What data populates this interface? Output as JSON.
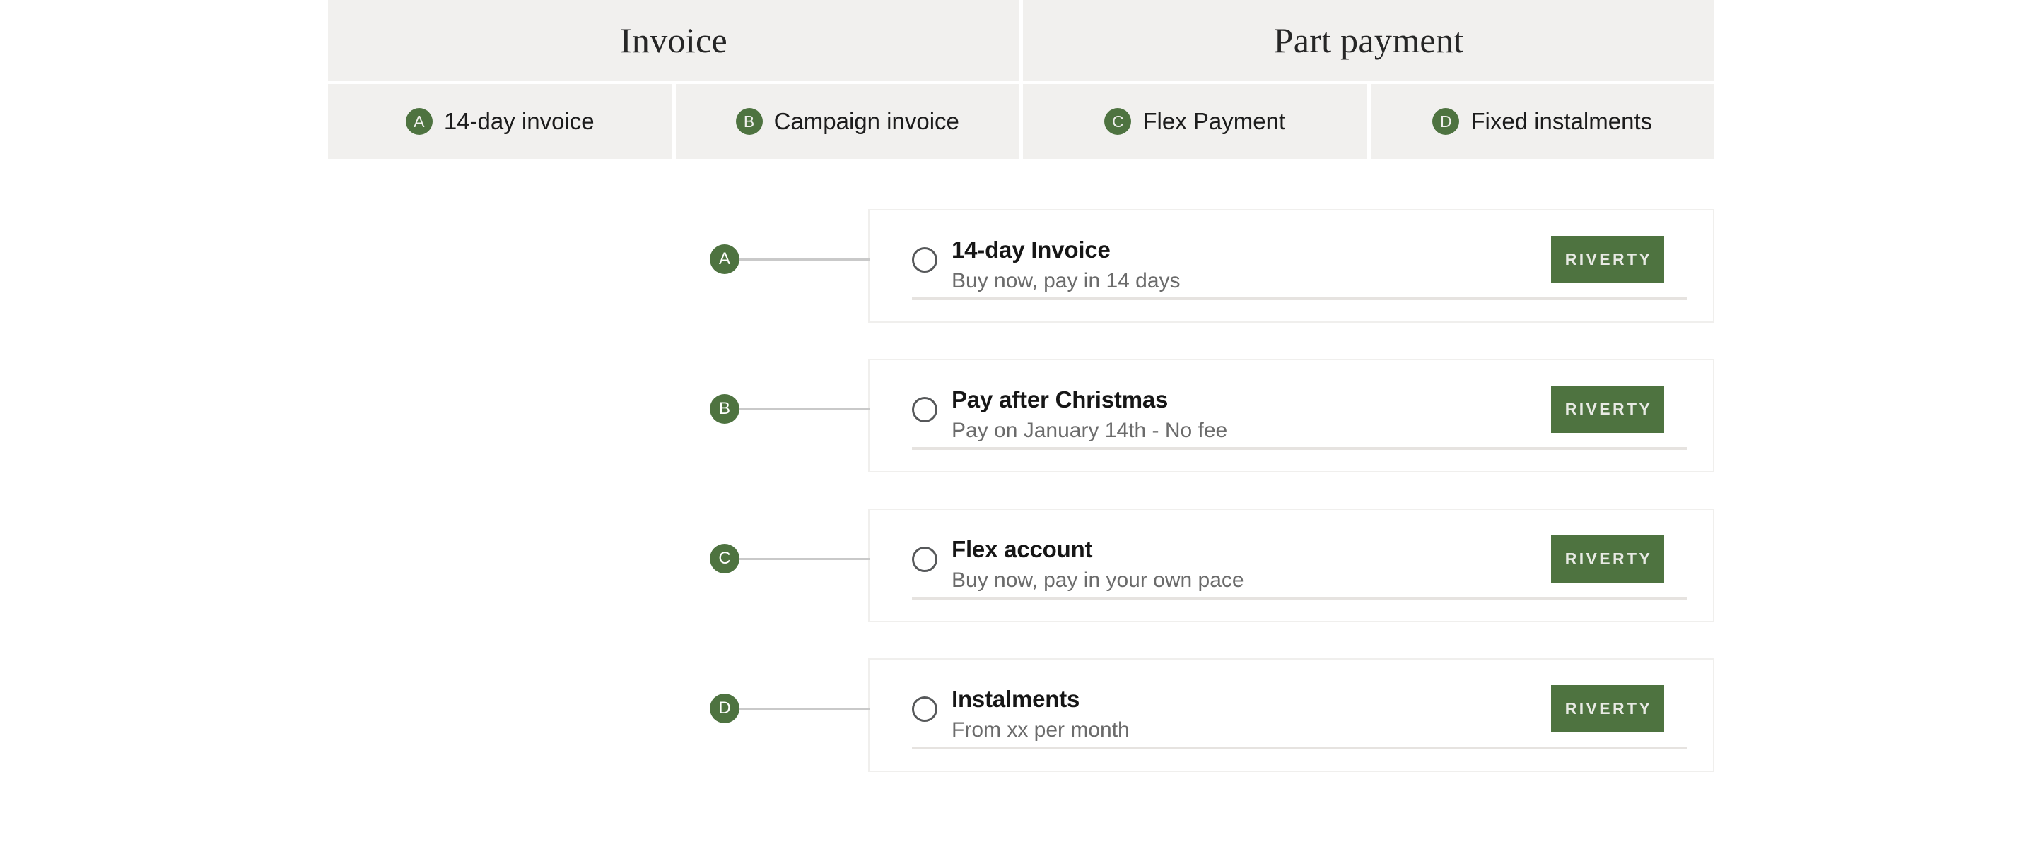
{
  "colors": {
    "brand_green": "#4e7340",
    "header_cell_bg": "#f1f0ee",
    "page_bg": "#ffffff",
    "card_border": "#f0efed",
    "subtitle_text": "#6b6b6b",
    "divider": "#e6e3e0"
  },
  "header": {
    "groups": [
      {
        "title": "Invoice"
      },
      {
        "title": "Part payment"
      }
    ],
    "tabs": [
      {
        "badge": "A",
        "label": "14-day invoice"
      },
      {
        "badge": "B",
        "label": "Campaign invoice"
      },
      {
        "badge": "C",
        "label": "Flex Payment"
      },
      {
        "badge": "D",
        "label": "Fixed instalments"
      }
    ]
  },
  "options": [
    {
      "badge": "A",
      "title": "14-day Invoice",
      "subtitle": "Buy now, pay in 14 days",
      "logo_text": "riverty",
      "selected": false
    },
    {
      "badge": "B",
      "title": "Pay after Christmas",
      "subtitle": "Pay on January 14th - No fee",
      "logo_text": "riverty",
      "selected": false
    },
    {
      "badge": "C",
      "title": "Flex account",
      "subtitle": "Buy now, pay in your own pace",
      "logo_text": "riverty",
      "selected": false
    },
    {
      "badge": "D",
      "title": "Instalments",
      "subtitle": "From xx per month",
      "logo_text": "riverty",
      "selected": false
    }
  ]
}
